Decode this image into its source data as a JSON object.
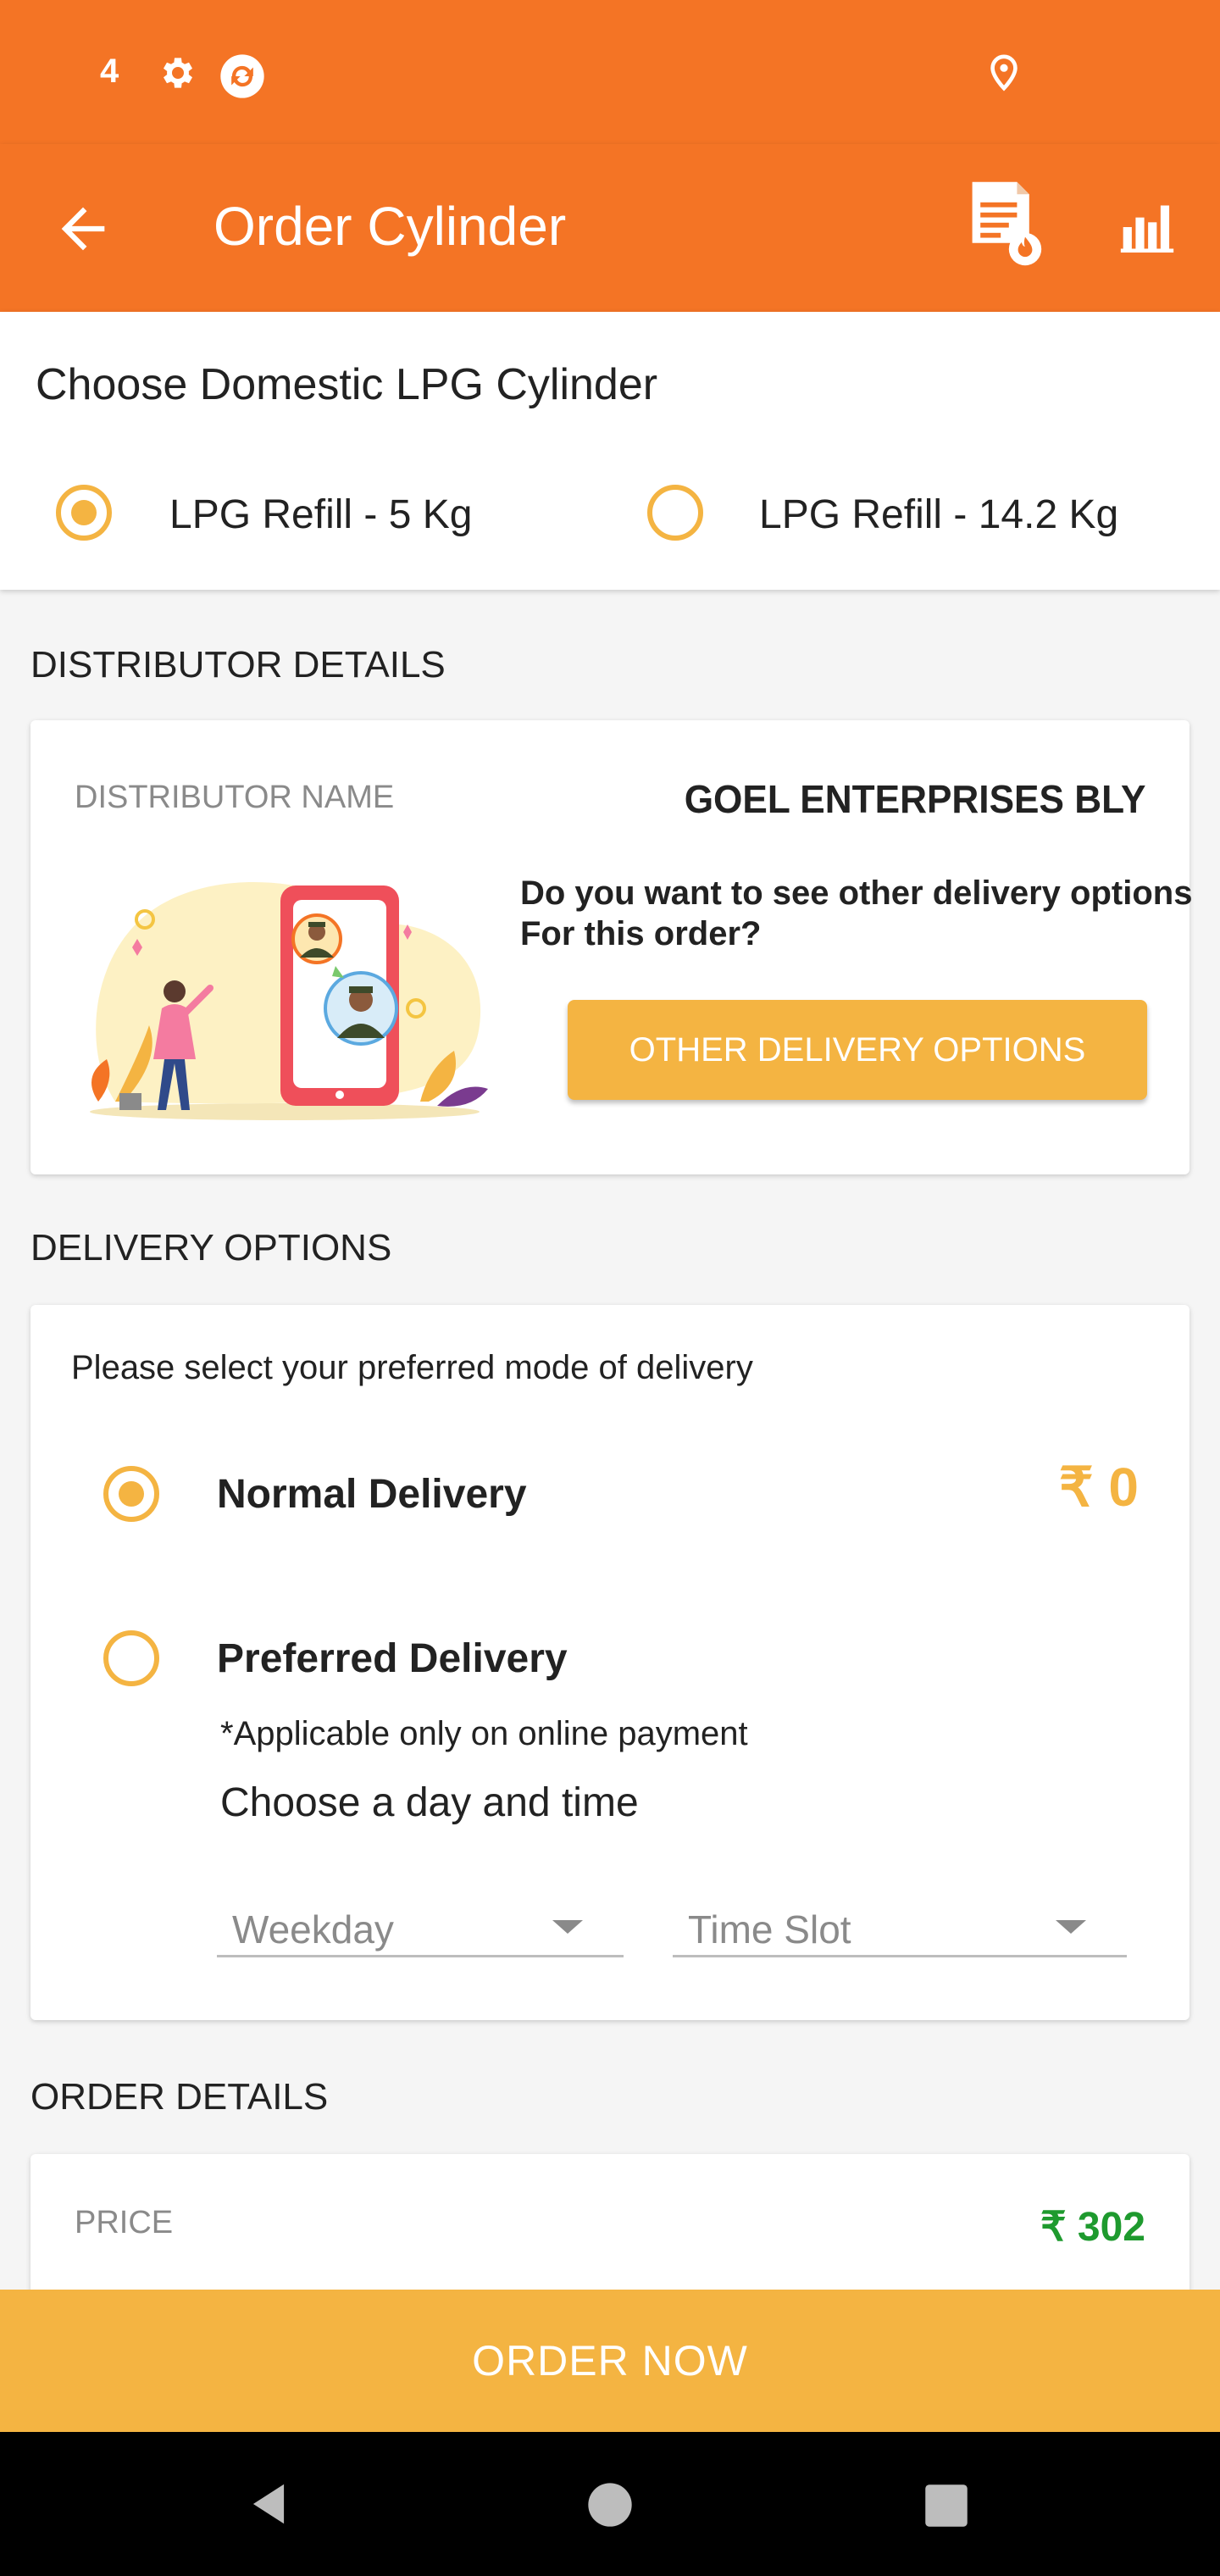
{
  "status_bar": {
    "notification_count": "4"
  },
  "app_bar": {
    "title": "Order Cylinder"
  },
  "cylinder_section": {
    "heading": "Choose Domestic LPG Cylinder",
    "options": [
      {
        "label": "LPG Refill - 5 Kg",
        "selected": true
      },
      {
        "label": "LPG Refill - 14.2 Kg",
        "selected": false
      }
    ]
  },
  "distributor_section": {
    "header": "DISTRIBUTOR DETAILS",
    "name_label": "DISTRIBUTOR NAME",
    "name_value": "GOEL ENTERPRISES BLY",
    "question": "Do you want to see other delivery options For this order?",
    "button_label": "OTHER DELIVERY OPTIONS"
  },
  "delivery_section": {
    "header": "DELIVERY OPTIONS",
    "prompt": "Please select your preferred mode of delivery",
    "normal": {
      "label": "Normal Delivery",
      "price": "₹ 0",
      "selected": true
    },
    "preferred": {
      "label": "Preferred Delivery",
      "selected": false
    },
    "note": "*Applicable only on online payment",
    "choose_label": "Choose a day and time",
    "weekday_placeholder": "Weekday",
    "timeslot_placeholder": "Time Slot"
  },
  "order_section": {
    "header": "ORDER DETAILS",
    "price_label": "PRICE",
    "price_value": "₹ 302"
  },
  "order_button_label": "ORDER NOW",
  "colors": {
    "primary_orange": "#f47425",
    "accent_yellow": "#f4b442",
    "price_green": "#1e9a2e"
  }
}
